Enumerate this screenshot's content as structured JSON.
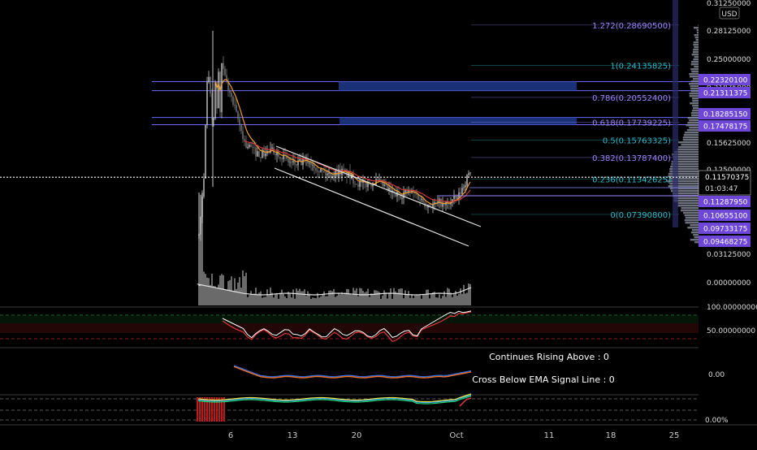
{
  "colors": {
    "background": "#000000",
    "candle_up": "#c9c9c9",
    "candle_down": "#7a7a7a",
    "ema_orange": "#f0a030",
    "ema_red": "#d03a3a",
    "fib_teal": "#2fb8c8",
    "fib_purple": "#9c84ff",
    "price_line": "#ffffff",
    "zone_blue": "#1e3a8c",
    "zone_line": "#6a6aff",
    "volume_profile": "#8f95a5",
    "label_purple": "#6e46d8",
    "trendline": "#e8e8e8",
    "rsi_line": "#ffffff",
    "rsi_signal": "#e03a3a",
    "macd_blue": "#2f6ad8",
    "macd_orange": "#f07028",
    "osc_green": "#20d870",
    "osc_yellow": "#e8e040",
    "osc_blue": "#3aa0ff",
    "osc_red_hist": "#c01818"
  },
  "header": {
    "currency": "USD"
  },
  "price_axis": {
    "ticks": [
      "0.31250000",
      "0.28125000",
      "0.25000000",
      "0.21875000",
      "0.18750000",
      "0.15625000",
      "0.12500000",
      "0.03125000",
      "0.00000000"
    ],
    "current_price": "0.11570375",
    "countdown": "01:03:47",
    "zone_labels": [
      "0.22320100",
      "0.21311375",
      "0.18285150",
      "0.17478175",
      "0.11287950",
      "0.10655100",
      "0.09733175",
      "0.09468275"
    ]
  },
  "fib_levels": [
    {
      "label": "1.272(0.28690500)",
      "color": "#9c84ff"
    },
    {
      "label": "1(0.24135825)",
      "color": "#2fb8c8"
    },
    {
      "label": "0.786(0.20552400)",
      "color": "#9c84ff"
    },
    {
      "label": "0.618(0.17739225)",
      "color": "#9c84ff"
    },
    {
      "label": "0.5(0.15763325)",
      "color": "#2fb8c8"
    },
    {
      "label": "0.382(0.13787400)",
      "color": "#9c84ff"
    },
    {
      "label": "0.236(0.11342625)",
      "color": "#2fb8c8"
    },
    {
      "label": "0(0.07390800)",
      "color": "#2fb8c8"
    }
  ],
  "rsi_pane": {
    "ticks": [
      "100.00000000",
      "50.00000000"
    ]
  },
  "macd_pane": {
    "tick": "0.00",
    "text_rising": "Continues Rising Above : 0",
    "text_cross": "Cross Below EMA Signal Line : 0"
  },
  "osc_pane": {
    "tick": "0.00%"
  },
  "time_axis": {
    "labels": [
      "6",
      "13",
      "20",
      "Oct",
      "11",
      "18",
      "25"
    ]
  },
  "chart_data": {
    "type": "line",
    "title": "",
    "x": [
      "6",
      "13",
      "20",
      "Oct"
    ],
    "xlabel": "",
    "ylabel": "",
    "ylim": [
      0,
      0.3125
    ],
    "series": [
      {
        "name": "",
        "x": [
          "6",
          "13",
          "20",
          "Oct"
        ],
        "y": [
          0.26,
          0.145,
          0.12,
          0.115
        ]
      }
    ],
    "current_price": 0.11570375,
    "fib_retracement": {
      "1.272": 0.286905,
      "1": 0.24135825,
      "0.786": 0.205524,
      "0.618": 0.17739225,
      "0.5": 0.15763325,
      "0.382": 0.137874,
      "0.236": 0.11342625,
      "0": 0.073908
    },
    "zones": [
      {
        "top": 0.223201,
        "bottom": 0.21311375
      },
      {
        "top": 0.1828515,
        "bottom": 0.17478175
      }
    ],
    "panes": [
      "price",
      "rsi",
      "macd",
      "oscillator"
    ],
    "grid": false,
    "legend": "none"
  }
}
